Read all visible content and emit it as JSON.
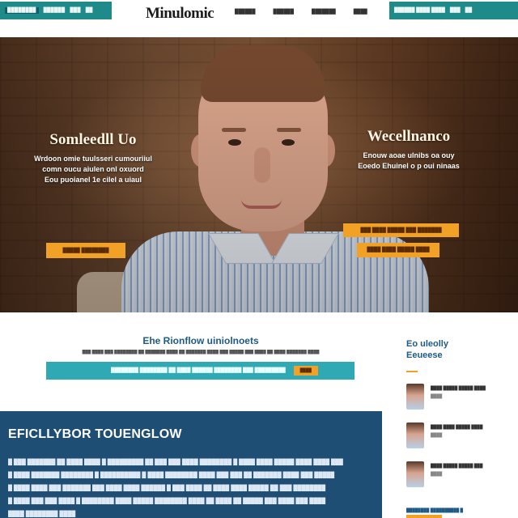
{
  "colors": {
    "teal": "#1f8a8a",
    "accent_orange": "#f2a127",
    "feature_blue": "#1f4e74",
    "heading_blue": "#1d5a86"
  },
  "topbar": {
    "left_items": [
      "████████",
      "██████",
      "███",
      "██"
    ],
    "logo": "Minulomic",
    "nav": [
      "██████",
      "██████",
      "███████",
      "████"
    ],
    "right_items": [
      "██████ ████ ████",
      "███",
      "██"
    ]
  },
  "hero": {
    "left": {
      "title": "Somleedll Uo",
      "lines": [
        "Wrdoon omie tuulsseri cumouriiul",
        "comn oucu aiulen onl oxuord",
        "Eou puoianel 1e cilel a uiaul"
      ],
      "cta": "█████ ████████"
    },
    "right": {
      "title": "Wecellnanco",
      "lines": [
        "Enouw aoae ulnibs oa ouy",
        "Eoedo Ehuinel o p oui ninaas"
      ],
      "cta_primary": "███ ████ █████ ███ ███████",
      "cta_secondary": "████ ████ █████ ████"
    },
    "icons": [
      "person-photo",
      "brick-wall-background"
    ]
  },
  "content": {
    "section_title": "Ehe Rionflow uiniolnoets",
    "section_sub": "███ ████ ███ ████████ ██ ███████ ████ ██ ███████ ████ ███ █████ ███ ████ ██ ████ ███████ ████",
    "subscribe_text": "████████ ████████ ██ ████ ██████ ████████ ███ █████████",
    "subscribe_button": "████"
  },
  "feature": {
    "title": "EFICLLYBOR TOUENGLOW",
    "lines": [
      "█ ███ ███████ ██ ████ ████ █ █████████ ██ ███ ███ ████ ████████ █ ████ ████ █████ ████ ████ ███",
      "█ ████ ███████ ████████ █ ██████████ █ ████ ████████ ████ ███ ███ ██ ███████ ████ ███ █████",
      "█ ████ ████ ███ ███████ ███ ████ ████ ██████ █ ███ ████ ██ ████ ████ █████ ██ ███ ████████",
      "█ ████ ███ ███ ████ █ ████████ ████ █████ ████████ ████ ██ ████ ██ █████ ███ ████ ███ ████",
      "████ ████████ ████"
    ]
  },
  "sidebar": {
    "title": "Eo uleolly Eeueese",
    "items": [
      {
        "text": "████ █████ █████ ████",
        "sub": "████"
      },
      {
        "text": "████ ████ █████ ████",
        "sub": "████"
      },
      {
        "text": "████ █████ █████ ███",
        "sub": "████"
      }
    ],
    "bottom": "████████ ██████████ █"
  }
}
